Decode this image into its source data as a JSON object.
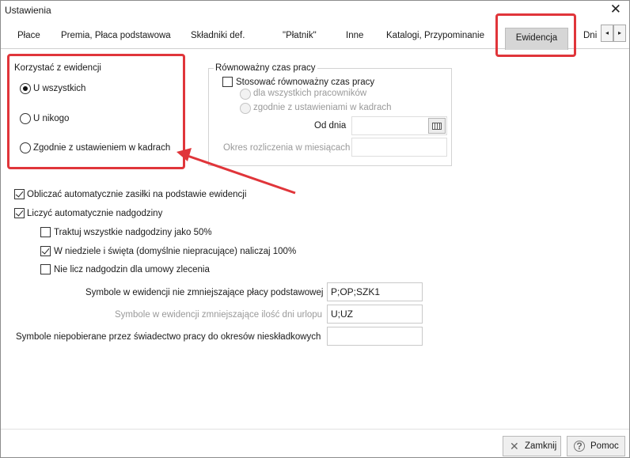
{
  "window": {
    "title": "Ustawienia",
    "close_glyph": "✕"
  },
  "tabs": [
    {
      "label": "Płace"
    },
    {
      "label": "Premia, Płaca podstawowa"
    },
    {
      "label": "Składniki def."
    },
    {
      "label": "\"Płatnik\""
    },
    {
      "label": "Inne"
    },
    {
      "label": "Katalogi, Przypominanie"
    },
    {
      "label": "Ewidencja",
      "active": true
    },
    {
      "label": "Dni"
    }
  ],
  "tab_scroll": {
    "left": "◂",
    "right": "▸"
  },
  "korzystac": {
    "legend": "Korzystać z ewidencji",
    "options": [
      {
        "label": "U wszystkich",
        "checked": true
      },
      {
        "label": "U nikogo",
        "checked": false
      },
      {
        "label": "Zgodnie z ustawieniem w kadrach",
        "checked": false
      }
    ]
  },
  "rownowazny": {
    "legend": "Równoważny czas pracy",
    "stosowac_label": "Stosować równoważny czas pracy",
    "stosowac_checked": false,
    "options": [
      {
        "label": "dla wszystkich pracowników"
      },
      {
        "label": "zgodnie z ustawieniami w kadrach"
      }
    ],
    "od_dnia_label": "Od dnia",
    "od_dnia_value": "",
    "okres_label": "Okres rozliczenia w miesiącach",
    "okres_value": ""
  },
  "checks": {
    "obliczac": {
      "label": "Obliczać automatycznie zasiłki na podstawie ewidencji",
      "checked": true
    },
    "liczyc": {
      "label": "Liczyć automatycznie nadgodziny",
      "checked": true
    },
    "traktuj": {
      "label": "Traktuj wszystkie nadgodziny jako 50%",
      "checked": false
    },
    "niedziele": {
      "label": "W niedziele i święta (domyślnie niepracujące) naliczaj 100%",
      "checked": true
    },
    "nie_licz": {
      "label": "Nie licz nadgodzin dla umowy zlecenia",
      "checked": false
    }
  },
  "symbols": {
    "niezmniejszajace_label": "Symbole w ewidencji nie zmniejszające płacy podstawowej",
    "niezmniejszajace_value": "P;OP;SZK1",
    "zmniejszajace_label": "Symbole w ewidencji zmniejszające ilość dni urlopu",
    "zmniejszajace_value": "U;UZ",
    "niepobierane_label": "Symbole niepobierane przez świadectwo pracy do okresów nieskładkowych",
    "niepobierane_value": ""
  },
  "buttons": {
    "zamknij": {
      "label": "Zamknij",
      "icon": "close-icon"
    },
    "pomoc": {
      "label": "Pomoc",
      "icon": "help-icon"
    }
  },
  "annotation": {
    "highlight_color": "#e0353a"
  }
}
